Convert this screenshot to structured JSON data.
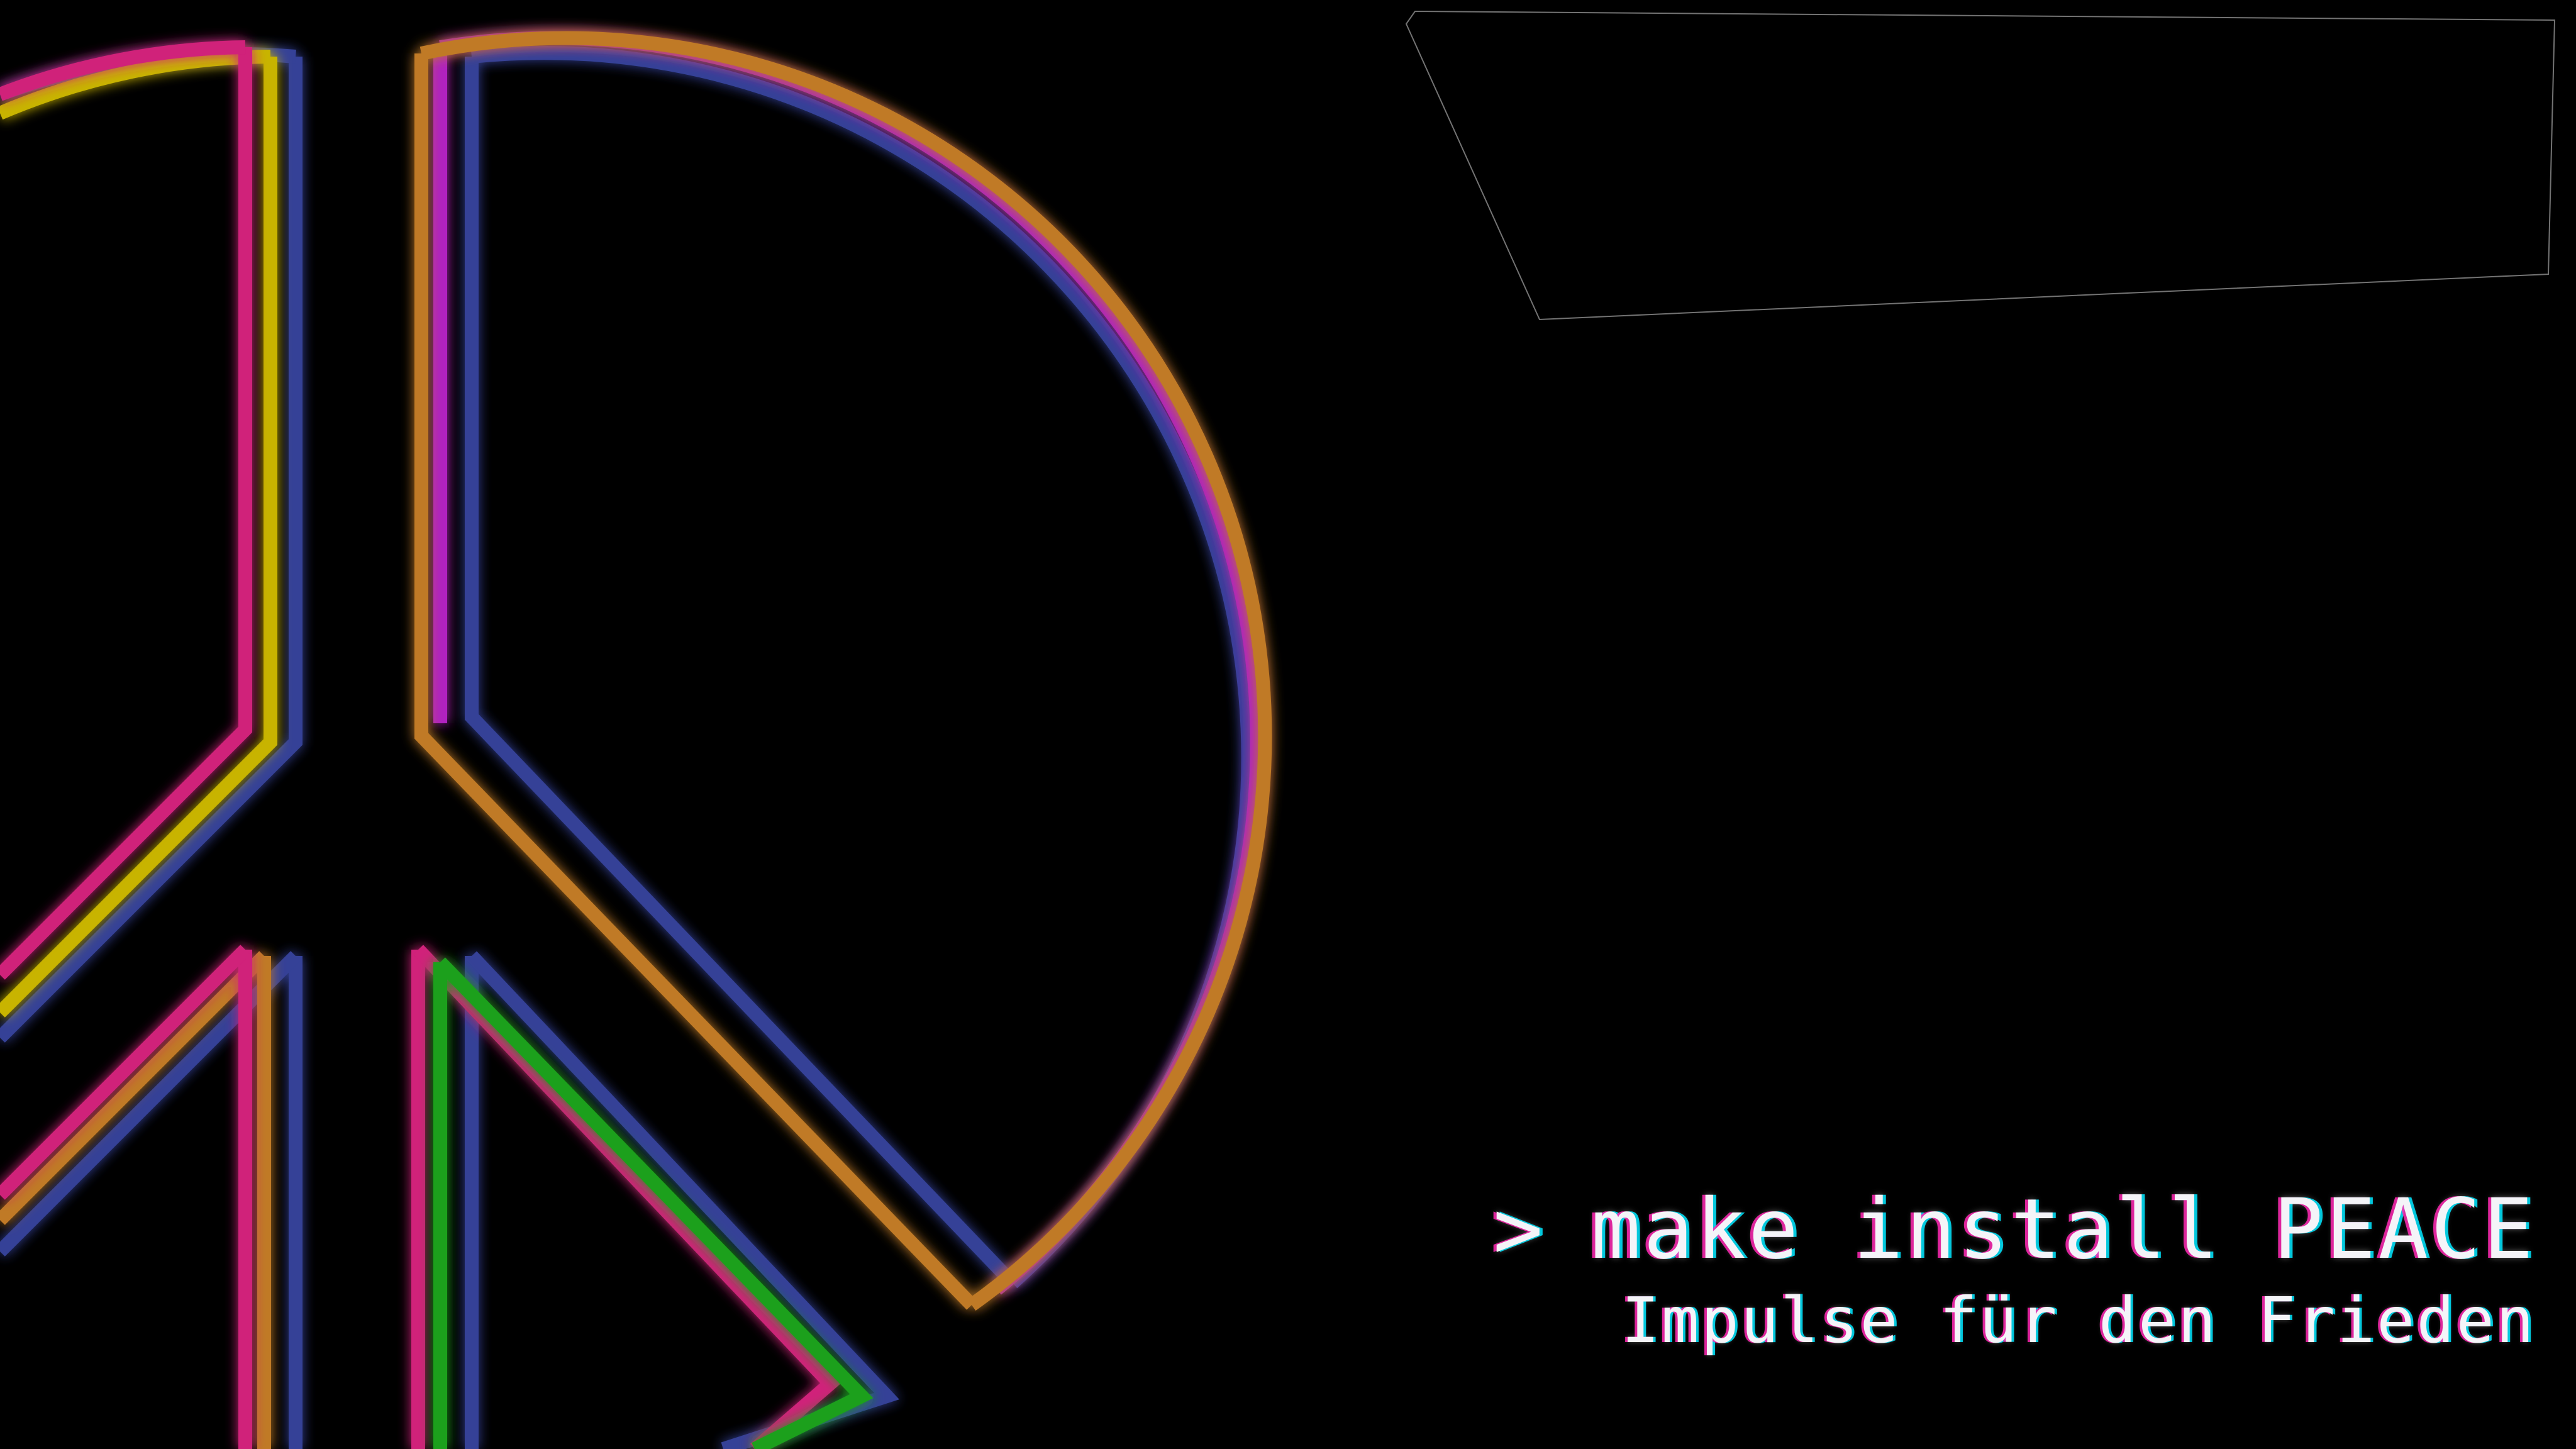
{
  "terminal": {
    "prompt": ">",
    "command": "make install PEACE",
    "subtitle": "Impulse für den Frieden"
  },
  "colors": {
    "background": "#000000",
    "neon_yellow": "#c8b400",
    "neon_magenta": "#b020c0",
    "neon_blue": "#3a4aa8",
    "neon_orange": "#c07a28",
    "neon_pink": "#d0207a",
    "neon_green": "#1fa01f",
    "text": "#f4f4f8",
    "glitch_pink": "#ff28b4",
    "glitch_cyan": "#00e6ff"
  },
  "icons": {
    "peace_symbol": "peace-sign-icon"
  }
}
